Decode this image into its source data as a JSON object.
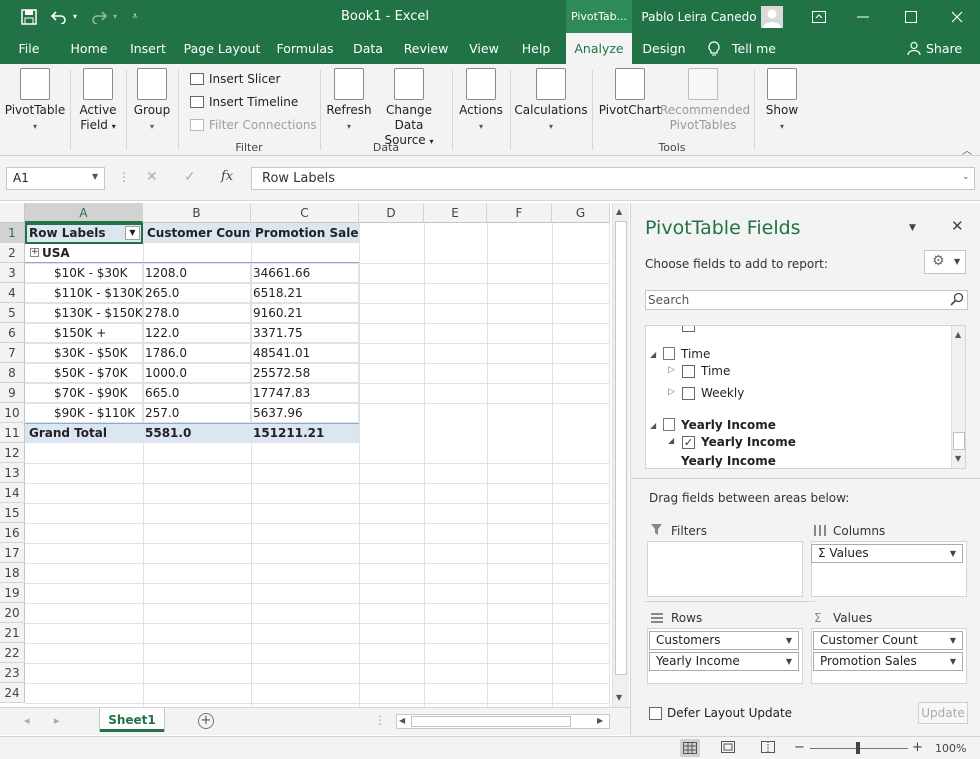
{
  "titlebar": {
    "title": "Book1  -  Excel",
    "context_label": "PivotTab...",
    "user": "Pablo Leira Canedo"
  },
  "tabs": [
    "File",
    "Home",
    "Insert",
    "Page Layout",
    "Formulas",
    "Data",
    "Review",
    "View",
    "Help",
    "Analyze",
    "Design"
  ],
  "tell_me": "Tell me",
  "share": "Share",
  "ribbon": {
    "pivottable": "PivotTable",
    "active_field_1": "Active",
    "active_field_2": "Field",
    "group": "Group",
    "insert_slicer": "Insert Slicer",
    "insert_timeline": "Insert Timeline",
    "filter_connections": "Filter Connections",
    "filter_group": "Filter",
    "refresh": "Refresh",
    "change_data_1": "Change Data",
    "change_data_2": "Source",
    "data_group": "Data",
    "actions": "Actions",
    "calculations": "Calculations",
    "pivotchart": "PivotChart",
    "recommended_1": "Recommended",
    "recommended_2": "PivotTables",
    "tools_group": "Tools",
    "show": "Show"
  },
  "formula": {
    "namebox": "A1",
    "fx": "fx",
    "content": "Row Labels"
  },
  "columns": [
    "A",
    "B",
    "C",
    "D",
    "E",
    "F",
    "G"
  ],
  "rows": [
    "1",
    "2",
    "3",
    "4",
    "5",
    "6",
    "7",
    "8",
    "9",
    "10",
    "11",
    "12",
    "13",
    "14",
    "15",
    "16",
    "17",
    "18",
    "19",
    "20",
    "21",
    "22",
    "23",
    "24"
  ],
  "pivot": {
    "header": [
      "Row Labels",
      "Customer Count",
      "Promotion Sales"
    ],
    "group": "USA",
    "data": [
      [
        "$10K - $30K",
        "1208.0",
        "34661.66"
      ],
      [
        "$110K - $130K",
        "265.0",
        "6518.21"
      ],
      [
        "$130K - $150K",
        "278.0",
        "9160.21"
      ],
      [
        "$150K +",
        "122.0",
        "3371.75"
      ],
      [
        "$30K - $50K",
        "1786.0",
        "48541.01"
      ],
      [
        "$50K - $70K",
        "1000.0",
        "25572.58"
      ],
      [
        "$70K - $90K",
        "665.0",
        "17747.83"
      ],
      [
        "$90K - $110K",
        "257.0",
        "5637.96"
      ]
    ],
    "total": [
      "Grand Total",
      "5581.0",
      "151211.21"
    ]
  },
  "sheet_tab": "Sheet1",
  "zoom": "100%",
  "pane": {
    "title": "PivotTable Fields",
    "subtitle": "Choose fields to add to report:",
    "search_placeholder": "Search",
    "fields": {
      "time": "Time",
      "time_child": "Time",
      "weekly": "Weekly",
      "yearly": "Yearly Income",
      "yearly_child": "Yearly Income",
      "yearly_child2": "Yearly Income"
    },
    "drag_label": "Drag fields between areas below:",
    "filters": "Filters",
    "columns": "Columns",
    "rows": "Rows",
    "values": "Values",
    "columns_items": [
      "Values"
    ],
    "rows_items": [
      "Customers",
      "Yearly Income"
    ],
    "values_items": [
      "Customer Count",
      "Promotion Sales"
    ],
    "defer": "Defer Layout Update",
    "update": "Update"
  }
}
